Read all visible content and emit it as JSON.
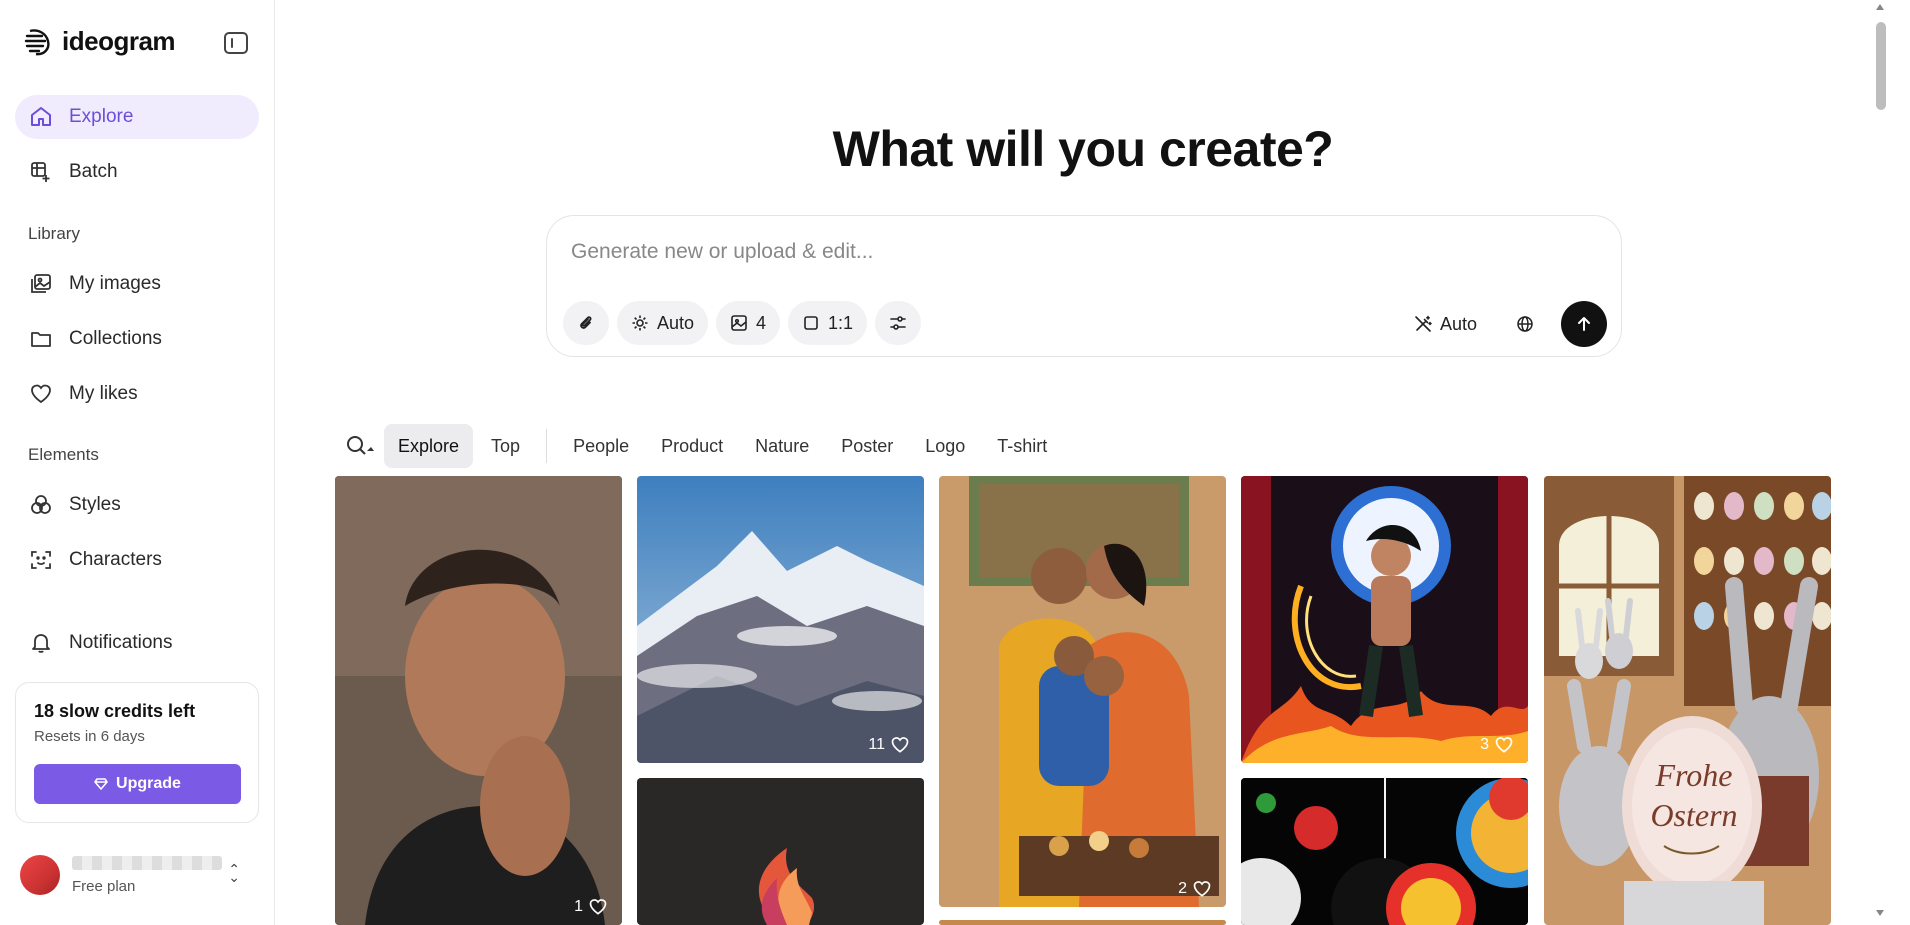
{
  "brand": {
    "name": "ideogram"
  },
  "sidebar": {
    "nav": [
      {
        "label": "Explore",
        "icon": "home-icon",
        "active": true
      },
      {
        "label": "Batch",
        "icon": "batch-icon",
        "active": false
      }
    ],
    "library_label": "Library",
    "library": [
      {
        "label": "My images",
        "icon": "images-icon"
      },
      {
        "label": "Collections",
        "icon": "folder-icon"
      },
      {
        "label": "My likes",
        "icon": "heart-icon"
      }
    ],
    "elements_label": "Elements",
    "elements": [
      {
        "label": "Styles",
        "icon": "styles-icon"
      },
      {
        "label": "Characters",
        "icon": "characters-icon"
      }
    ],
    "notifications": {
      "label": "Notifications",
      "icon": "bell-icon"
    },
    "credits": {
      "title": "18 slow credits left",
      "subtitle": "Resets in 6 days",
      "upgrade_label": "Upgrade"
    },
    "user": {
      "plan": "Free plan"
    }
  },
  "main": {
    "title": "What will you create?",
    "prompt": {
      "placeholder": "Generate new or upload & edit...",
      "value": "",
      "style_label": "Auto",
      "count_label": "4",
      "aspect_label": "1:1",
      "magic_label": "Auto"
    },
    "filters": [
      "Explore",
      "Top",
      "People",
      "Product",
      "Nature",
      "Poster",
      "Logo",
      "T-shirt"
    ],
    "active_filter": "Explore",
    "gallery": [
      {
        "desc": "thoughtful man portrait",
        "likes": "1"
      },
      {
        "desc": "snowy mountain peaks",
        "likes": "11"
      },
      {
        "desc": "family celebration",
        "likes": "2"
      },
      {
        "desc": "fire warrior",
        "likes": "3"
      },
      {
        "desc": "easter bunnies",
        "likes": ""
      },
      {
        "desc": "flame logo",
        "likes": ""
      },
      {
        "desc": "planets poster",
        "likes": ""
      }
    ],
    "egg_text": "Frohe Ostern"
  },
  "colors": {
    "accent": "#7b5ae6",
    "accent_bg": "#f1ecfd",
    "send": "#111111"
  }
}
